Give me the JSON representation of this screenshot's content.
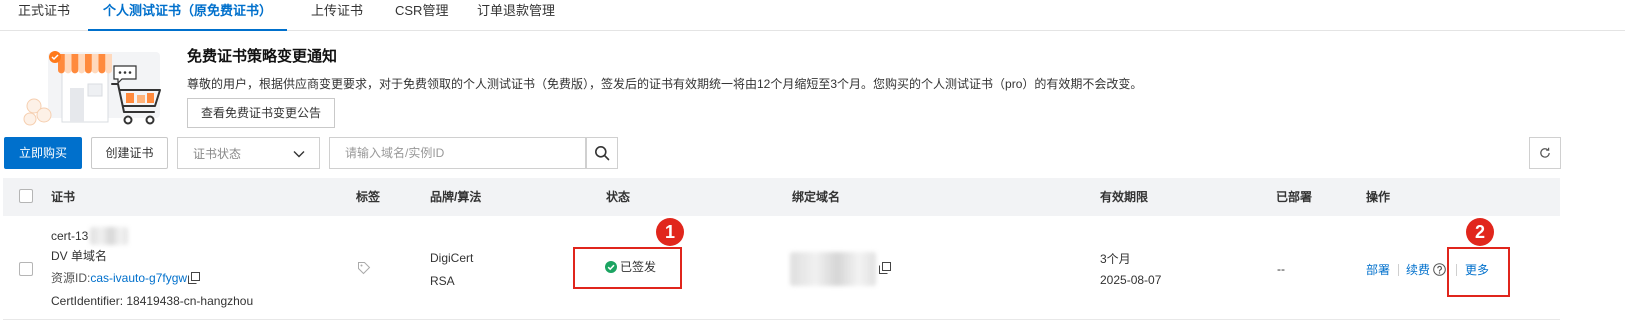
{
  "tabs": [
    {
      "label": "正式证书"
    },
    {
      "label": "个人测试证书（原免费证书）",
      "active": true
    },
    {
      "label": "上传证书"
    },
    {
      "label": "CSR管理"
    },
    {
      "label": "订单退款管理"
    }
  ],
  "notice": {
    "title": "免费证书策略变更通知",
    "description": "尊敬的用户，根据供应商变更要求，对于免费领取的个人测试证书（免费版），签发后的证书有效期统一将由12个月缩短至3个月。您购买的个人测试证书（pro）的有效期不会改变。",
    "button_label": "查看免费证书变更公告"
  },
  "toolbar": {
    "buy_label": "立即购买",
    "create_label": "创建证书",
    "status_select": {
      "placeholder": "证书状态"
    },
    "search": {
      "placeholder": "请输入域名/实例ID"
    }
  },
  "table": {
    "headers": {
      "cert": "证书",
      "tags": "标签",
      "brand": "品牌/算法",
      "status": "状态",
      "domain": "绑定域名",
      "validity": "有效期限",
      "deployed": "已部署",
      "actions": "操作"
    },
    "rows": [
      {
        "name": "cert-13",
        "type": "DV 单域名",
        "resource_id_label": "资源ID:",
        "resource_id": "cas-ivauto-g7fygw",
        "cert_identifier": "CertIdentifier: 18419438-cn-hangzhou",
        "brand": "DigiCert",
        "algorithm": "RSA",
        "status": "已签发",
        "validity_period": "3个月",
        "expiry_date": "2025-08-07",
        "deployed": "--",
        "actions": {
          "deploy": "部署",
          "renew": "续费",
          "more": "更多"
        }
      }
    ]
  },
  "annotations": [
    "1",
    "2"
  ],
  "icons": {
    "notice": "store-cart-illustration",
    "select": "chevron-down-icon",
    "search": "search-icon",
    "refresh": "refresh-icon",
    "tag": "tag-icon",
    "copy": "copy-icon",
    "status": "check-circle-icon",
    "help": "help-icon"
  },
  "colors": {
    "primary": "#0070cc",
    "success": "#1ca462",
    "annotation": "#e1261c",
    "table_header_bg": "#f2f3f5"
  }
}
